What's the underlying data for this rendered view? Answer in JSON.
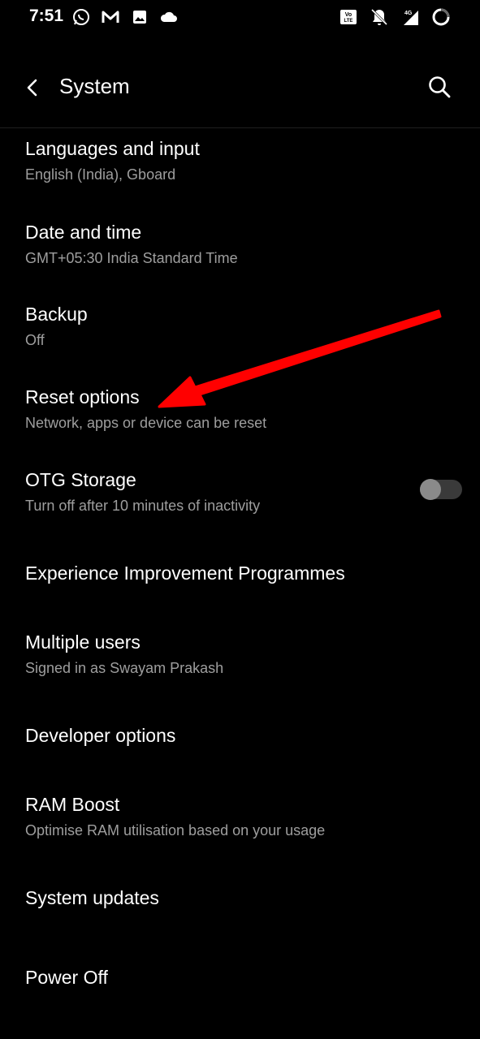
{
  "status_bar": {
    "time": "7:51",
    "left_icons": [
      "whatsapp-icon",
      "gmail-icon",
      "gallery-icon",
      "cloud-icon"
    ],
    "right_icons": [
      "volte-icon",
      "notifications-off-icon",
      "signal-4g-icon",
      "battery-icon"
    ],
    "network_label": "4G",
    "volte_label": "Vo LTE"
  },
  "app_bar": {
    "title": "System",
    "back_icon": "back-arrow-icon",
    "search_icon": "search-icon"
  },
  "settings": [
    {
      "title": "Languages and input",
      "subtitle": "English (India), Gboard"
    },
    {
      "title": "Date and time",
      "subtitle": "GMT+05:30 India Standard Time"
    },
    {
      "title": "Backup",
      "subtitle": "Off"
    },
    {
      "title": "Reset options",
      "subtitle": "Network, apps or device can be reset"
    },
    {
      "title": "OTG Storage",
      "subtitle": "Turn off after 10 minutes of inactivity",
      "toggle": "off"
    },
    {
      "title": "Experience Improvement Programmes"
    },
    {
      "title": "Multiple users",
      "subtitle": "Signed in as Swayam Prakash"
    },
    {
      "title": "Developer options"
    },
    {
      "title": "RAM Boost",
      "subtitle": "Optimise RAM utilisation based on your usage"
    },
    {
      "title": "System updates"
    },
    {
      "title": "Power Off"
    }
  ],
  "annotation": {
    "type": "arrow",
    "color": "#ff0000",
    "points_to": "Reset options"
  }
}
